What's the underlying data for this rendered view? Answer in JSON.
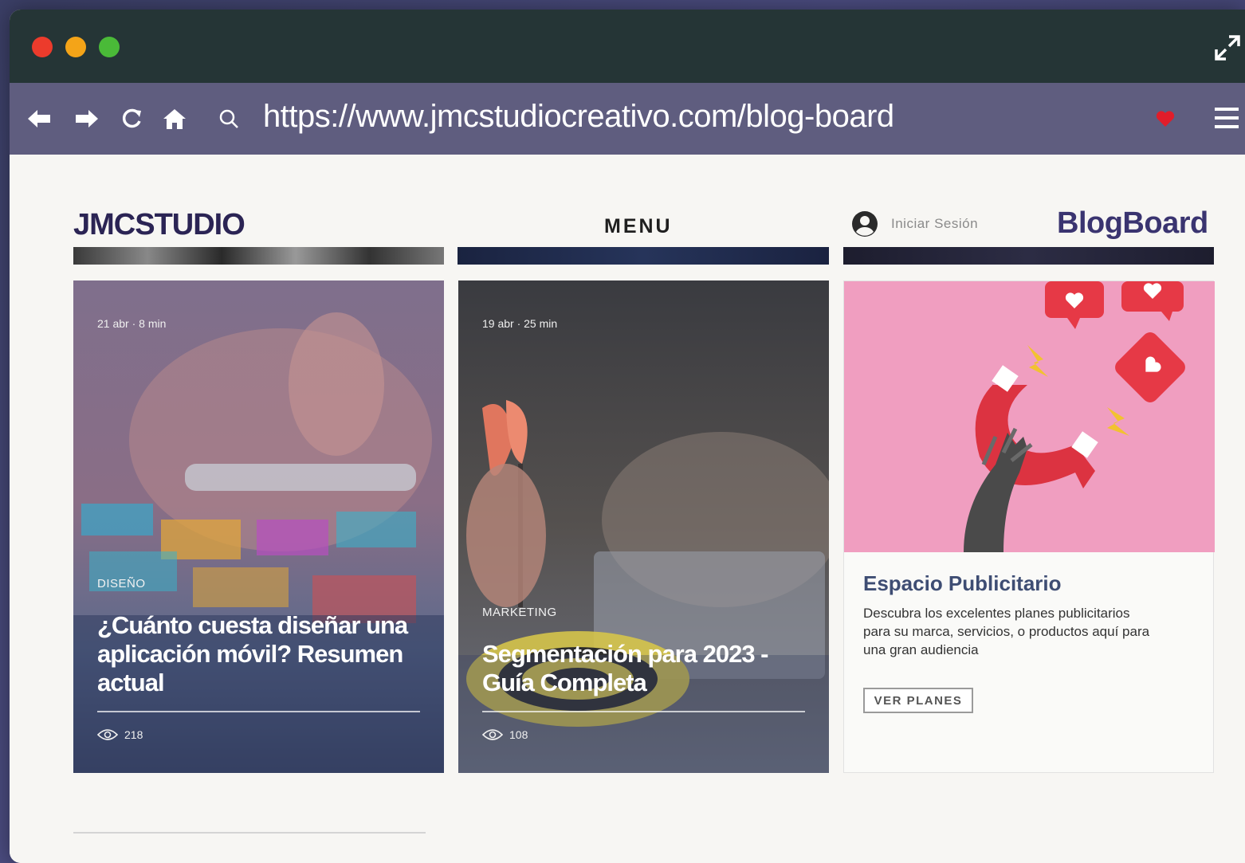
{
  "browser": {
    "url": "https://www.jmcstudiocreativo.com/blog-board"
  },
  "header": {
    "logo": "JMCSTUDIO",
    "menu": "MENU",
    "login": "Iniciar Sesión",
    "brand": "BlogBoard"
  },
  "cards": [
    {
      "meta": "21 abr · 8 min",
      "category": "DISEÑO",
      "title": "¿Cuánto cuesta diseñar una aplicación móvil? Resumen actual",
      "views": "218"
    },
    {
      "meta": "19 abr · 25 min",
      "category": "MARKETING",
      "title": "Segmentación para 2023 - Guía Completa",
      "views": "108"
    }
  ],
  "ad": {
    "title": "Espacio Publicitario",
    "description": "Descubra los excelentes planes publicitarios para su marca, servicios, o productos aquí para una gran audiencia",
    "button": "VER PLANES"
  },
  "colors": {
    "titlebar": "#253536",
    "toolbar": "#5f5d7f",
    "accent": "#3a3470",
    "ad_bg": "#f09ec0"
  }
}
